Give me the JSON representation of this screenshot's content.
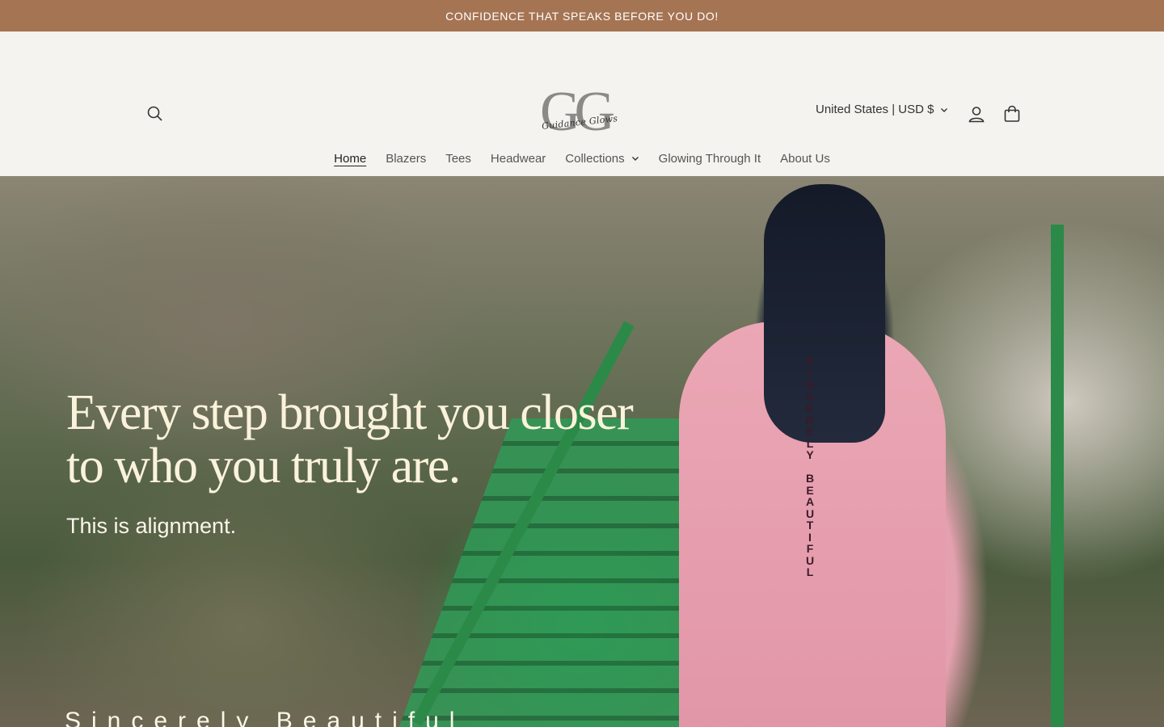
{
  "announcement": {
    "text": "CONFIDENCE THAT SPEAKS BEFORE YOU DO!"
  },
  "header": {
    "logo_mark": "GG",
    "logo_script": "Guidance Glows",
    "locale": "United States | USD $"
  },
  "icons": {
    "search": "search-icon",
    "account": "user-icon",
    "cart": "bag-icon",
    "chevron": "chevron-down-icon"
  },
  "nav": {
    "items": [
      {
        "label": "Home"
      },
      {
        "label": "Blazers"
      },
      {
        "label": "Tees"
      },
      {
        "label": "Headwear"
      },
      {
        "label": "Collections"
      },
      {
        "label": "Glowing Through It"
      },
      {
        "label": "About Us"
      }
    ]
  },
  "hero": {
    "headline_line1": "Every step brought you closer",
    "headline_line2": "to who you truly are.",
    "subheading": "This is alignment.",
    "brandline": "Sincerely Beautiful",
    "jacket_text": "SINCERELY BEAUTIFUL"
  },
  "colors": {
    "announcement_bg": "#a57453",
    "header_bg": "#f4f3ef",
    "headline": "#fbf2dc"
  }
}
